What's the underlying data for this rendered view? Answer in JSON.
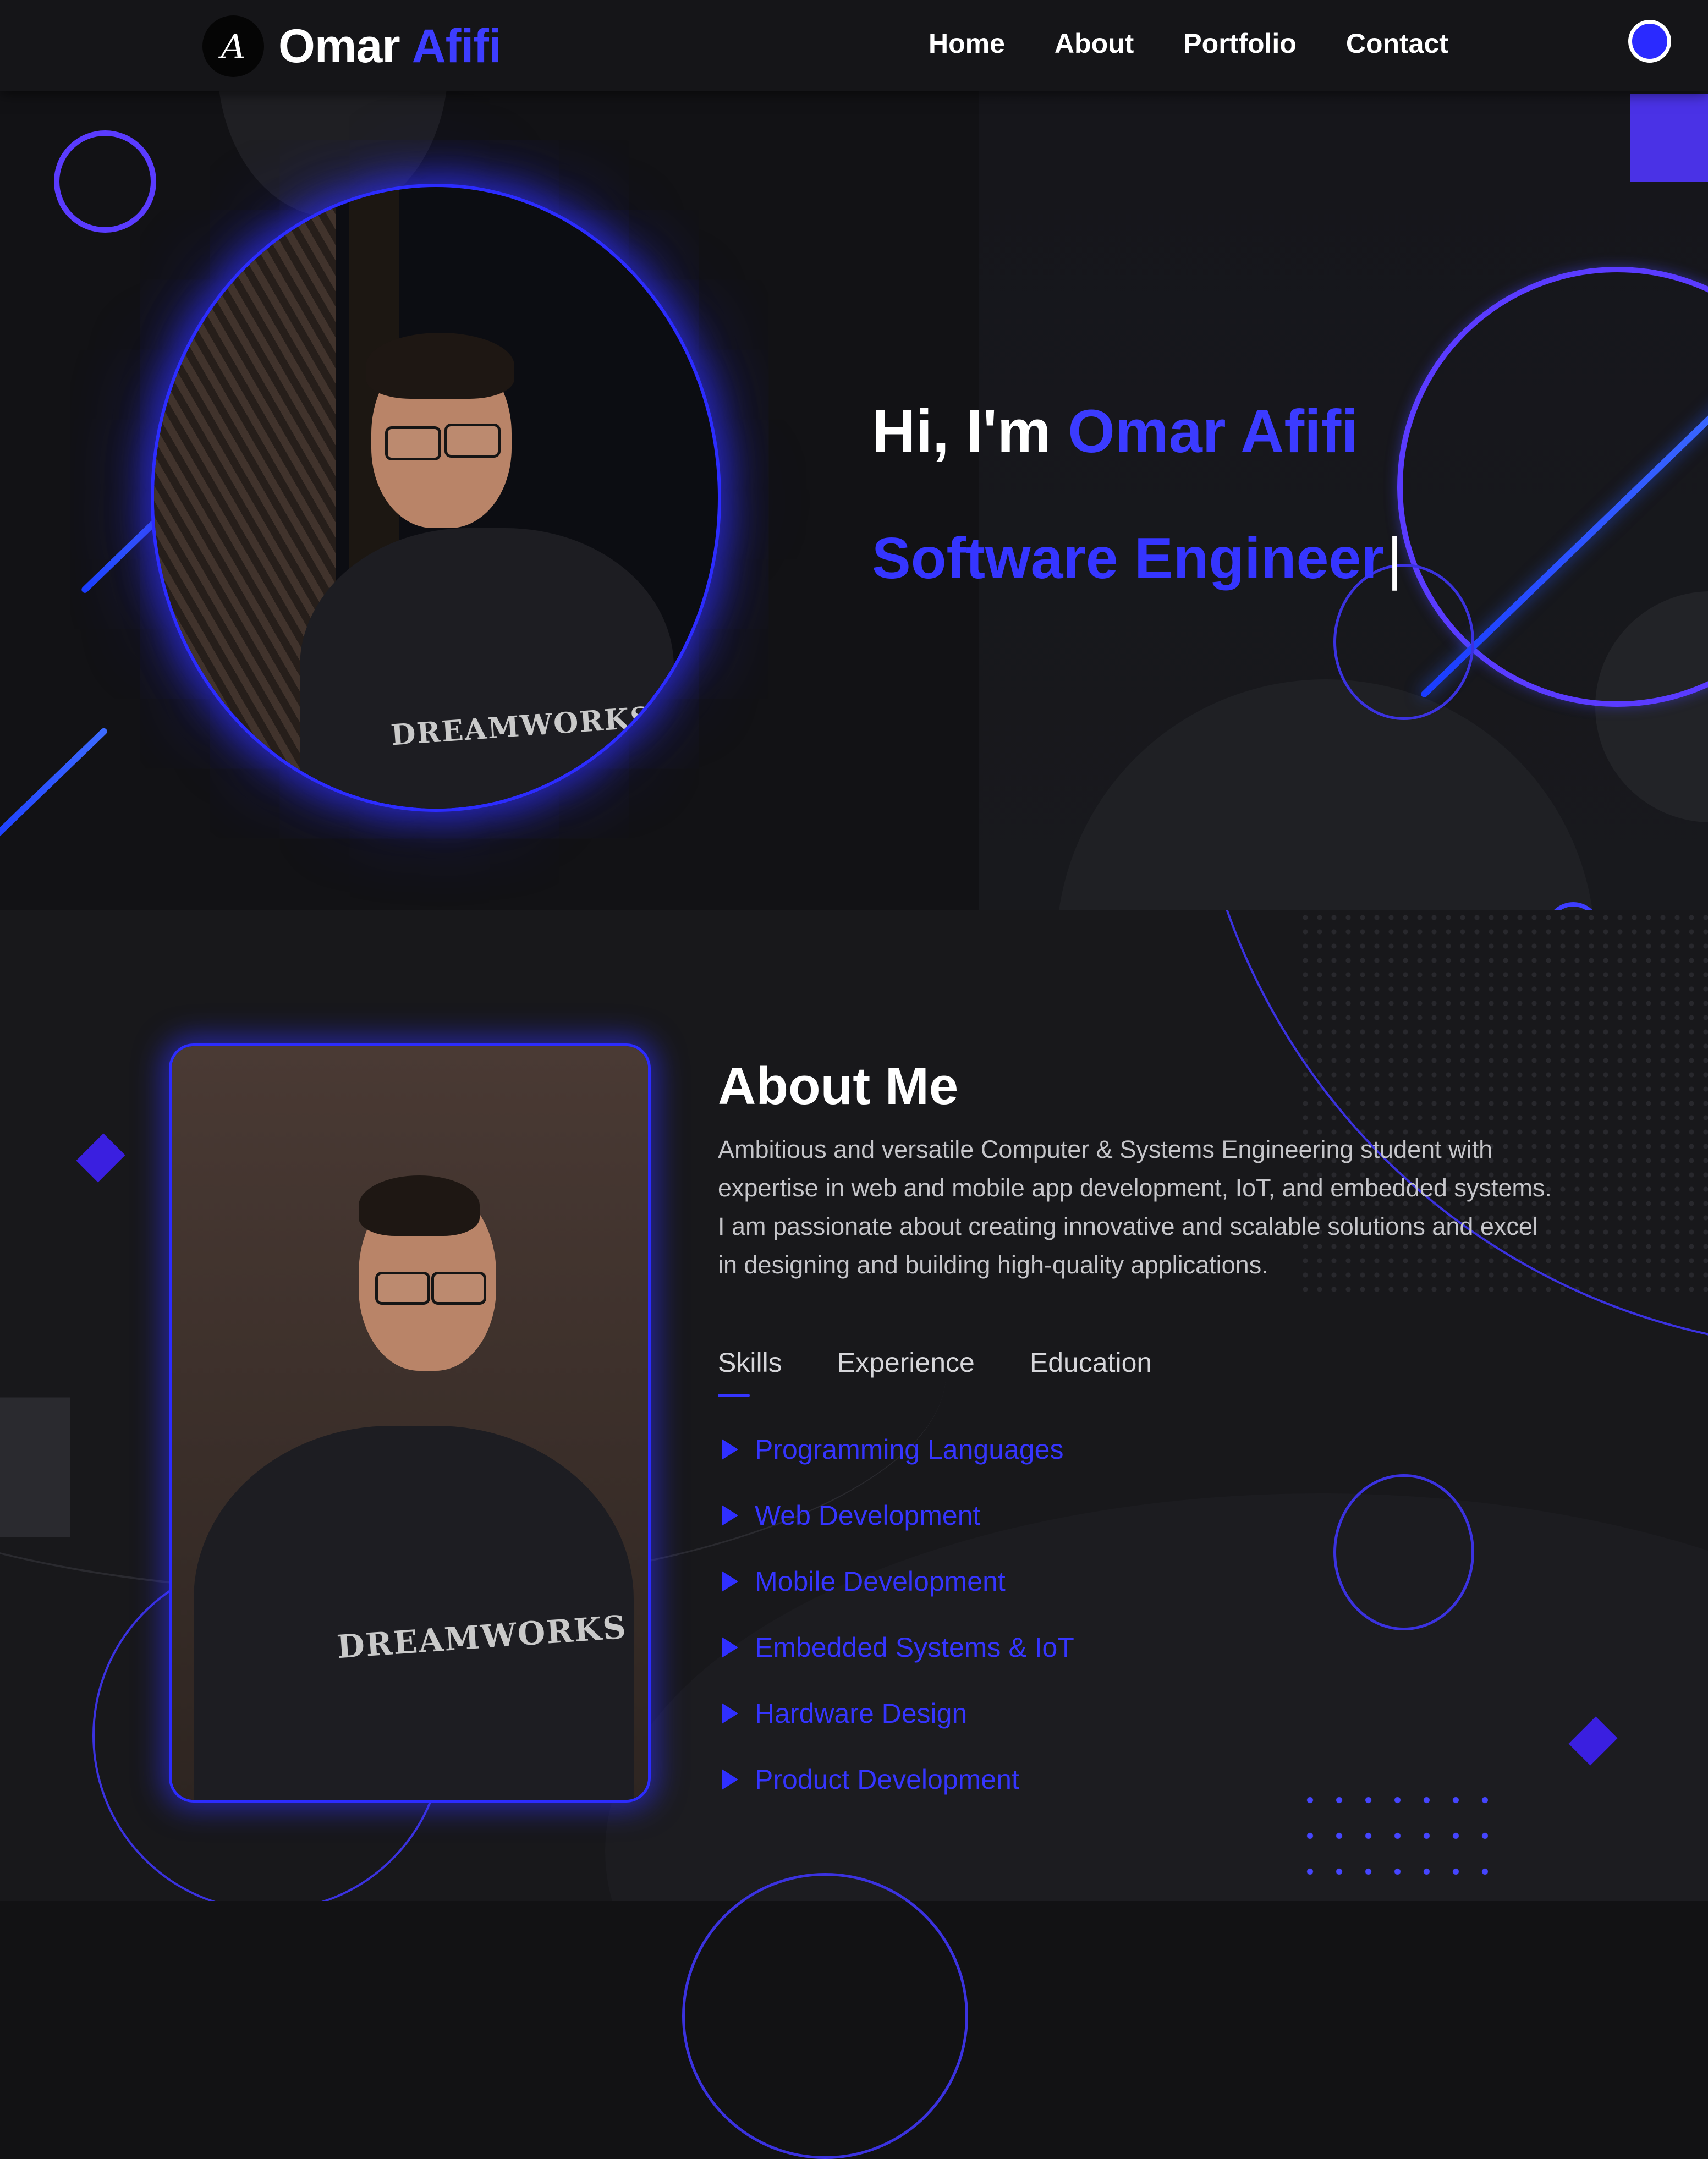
{
  "navbar": {
    "logo_monogram": "A",
    "brand_first": "Omar",
    "brand_last": "Afifi",
    "links": [
      "Home",
      "About",
      "Portfolio",
      "Contact"
    ]
  },
  "hero": {
    "greeting_prefix": "Hi, I'm",
    "greeting_name": "Omar Afifi",
    "role": "Software Engineer",
    "caret": "|",
    "shirt_text": "DREAMWORKS"
  },
  "about": {
    "title": "About Me",
    "description": "Ambitious and versatile Computer & Systems Engineering student with expertise in web and mobile app development, IoT, and embedded systems. I am passionate about creating innovative and scalable solutions and excel in designing and building high-quality applications.",
    "tabs": [
      "Skills",
      "Experience",
      "Education"
    ],
    "active_tab": "Skills",
    "skills": [
      "Programming Languages",
      "Web Development",
      "Mobile Development",
      "Embedded Systems & IoT",
      "Hardware Design",
      "Product Development"
    ],
    "shirt_text": "DREAMWORKS"
  },
  "colors": {
    "accent": "#3535ff",
    "accent_violet": "#5a3bff",
    "background": "#121214",
    "text": "#ffffff"
  },
  "icons": {
    "theme_toggle": "circle-toggle-icon",
    "skill_bullet": "triangle-right-icon"
  }
}
